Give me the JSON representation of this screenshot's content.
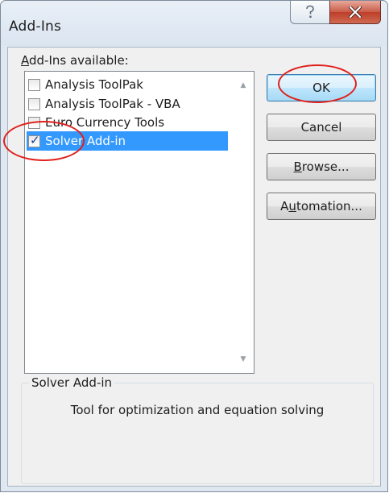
{
  "window": {
    "title": "Add-Ins",
    "help_glyph": "?",
    "close_glyph": "✕"
  },
  "addins": {
    "label_prefix": "A",
    "label_rest": "dd-Ins available:",
    "items": [
      {
        "label": "Analysis ToolPak",
        "checked": false,
        "selected": false
      },
      {
        "label": "Analysis ToolPak - VBA",
        "checked": false,
        "selected": false
      },
      {
        "label": "Euro Currency Tools",
        "checked": false,
        "selected": false
      },
      {
        "label": "Solver Add-in",
        "checked": true,
        "selected": true
      }
    ]
  },
  "buttons": {
    "ok": "OK",
    "cancel": "Cancel",
    "browse_acc": "B",
    "browse_rest": "rowse...",
    "automation_pre": "A",
    "automation_acc": "u",
    "automation_rest": "tomation..."
  },
  "description": {
    "title": "Solver Add-in",
    "text": "Tool for optimization and equation solving"
  },
  "icons": {
    "check": "✓",
    "scroll_up": "▲",
    "scroll_down": "▼"
  },
  "annotation_color": "#e0201c"
}
